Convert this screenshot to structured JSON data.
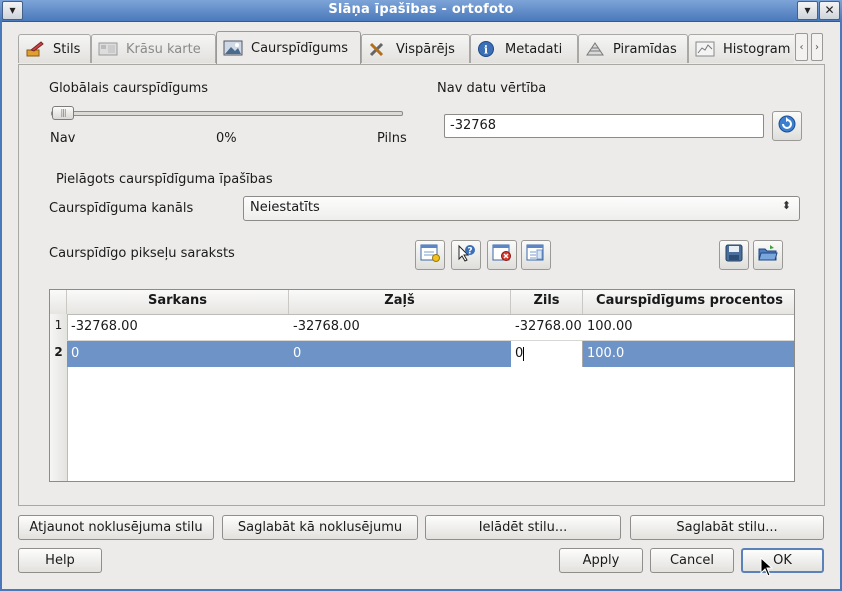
{
  "window": {
    "title": "Slāņa īpašības - ortofoto",
    "menu_icon": "▾",
    "minimize_icon": "▾",
    "close_icon": "✕"
  },
  "tabs": [
    {
      "label": "Stils",
      "icon": "paint-brush-icon",
      "state": "normal"
    },
    {
      "label": "Krāsu karte",
      "icon": "color-map-icon",
      "state": "disabled"
    },
    {
      "label": "Caurspīdīgums",
      "icon": "transparency-icon",
      "state": "active"
    },
    {
      "label": "Vispārējs",
      "icon": "tools-icon",
      "state": "normal"
    },
    {
      "label": "Metadati",
      "icon": "info-icon",
      "state": "normal"
    },
    {
      "label": "Piramīdas",
      "icon": "pyramid-icon",
      "state": "normal"
    },
    {
      "label": "Histogram",
      "icon": "histogram-icon",
      "state": "normal"
    }
  ],
  "tab_scroll": {
    "left": "‹",
    "right": "›"
  },
  "global_transparency": {
    "label": "Globālais caurspīdīgums",
    "min_label": "Nav",
    "value_label": "0%",
    "max_label": "Pilns",
    "value_fraction": 0.0
  },
  "no_data": {
    "label": "Nav datu vērtība",
    "value": "-32768"
  },
  "custom": {
    "section_label": "Pielāgots caurspīdīguma īpašības",
    "channel_label": "Caurspīdīguma kanāls",
    "channel_value": "Neiestatīts",
    "pixel_list_label": "Caurspīdīgo pikseļu saraksts"
  },
  "table": {
    "headers": [
      "Sarkans",
      "Zaļš",
      "Zils",
      "Caurspīdīgums procentos"
    ],
    "rows": [
      {
        "num": "1",
        "cells": [
          "-32768.00",
          "-32768.00",
          "-32768.00",
          "100.00"
        ]
      },
      {
        "num": "2",
        "cells": [
          "0",
          "0",
          "0",
          "100.0"
        ]
      }
    ]
  },
  "buttons": {
    "restore_default": "Atjaunot noklusējuma stilu",
    "save_default": "Saglabāt kā noklusējumu",
    "load_style": "Ielādēt stilu...",
    "save_style": "Saglabāt stilu...",
    "help": "Help",
    "apply": "Apply",
    "cancel": "Cancel",
    "ok": "OK"
  },
  "colors": {
    "titlebar": "#4a79bb",
    "selection": "#6e94c7"
  }
}
